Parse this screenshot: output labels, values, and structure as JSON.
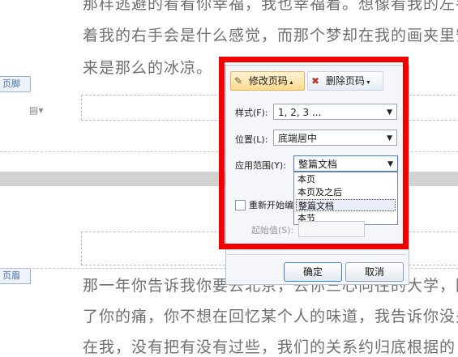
{
  "doc": {
    "line1": "那样逃避的看看你幸福，我也幸福着。想像看我的左手",
    "line2": "着我的右手会是什么感觉，而那个梦却在我的画夹里安",
    "line3": "来是那么的冰凉。",
    "line4": "那一年你告诉我你要去北京，去你三心向往的大学，因",
    "line5": "了你的痛，你不想在回忆某个人的味道，我告诉你没关",
    "line6": "在我，没有把有没有过些，我们的关系约归底根据的"
  },
  "footer_tag": "页脚",
  "header_tag": "页眉",
  "dialog": {
    "tab_modify": "修改页码",
    "tab_delete": "删除页码",
    "style_label": "样式(F):",
    "style_value": "1, 2, 3 ...",
    "position_label": "位置(L):",
    "position_value": "底端居中",
    "scope_label": "应用范围(Y):",
    "scope_value": "整篇文档",
    "scope_options": [
      "本页",
      "本页及之后",
      "整篇文档",
      "本节"
    ],
    "restart_label": "重新开始编",
    "start_label": "起始值(S):",
    "ok": "确定",
    "cancel": "取消"
  },
  "colors": {
    "highlight_frame": "#f20000",
    "active_tab": "#f9d98e"
  }
}
